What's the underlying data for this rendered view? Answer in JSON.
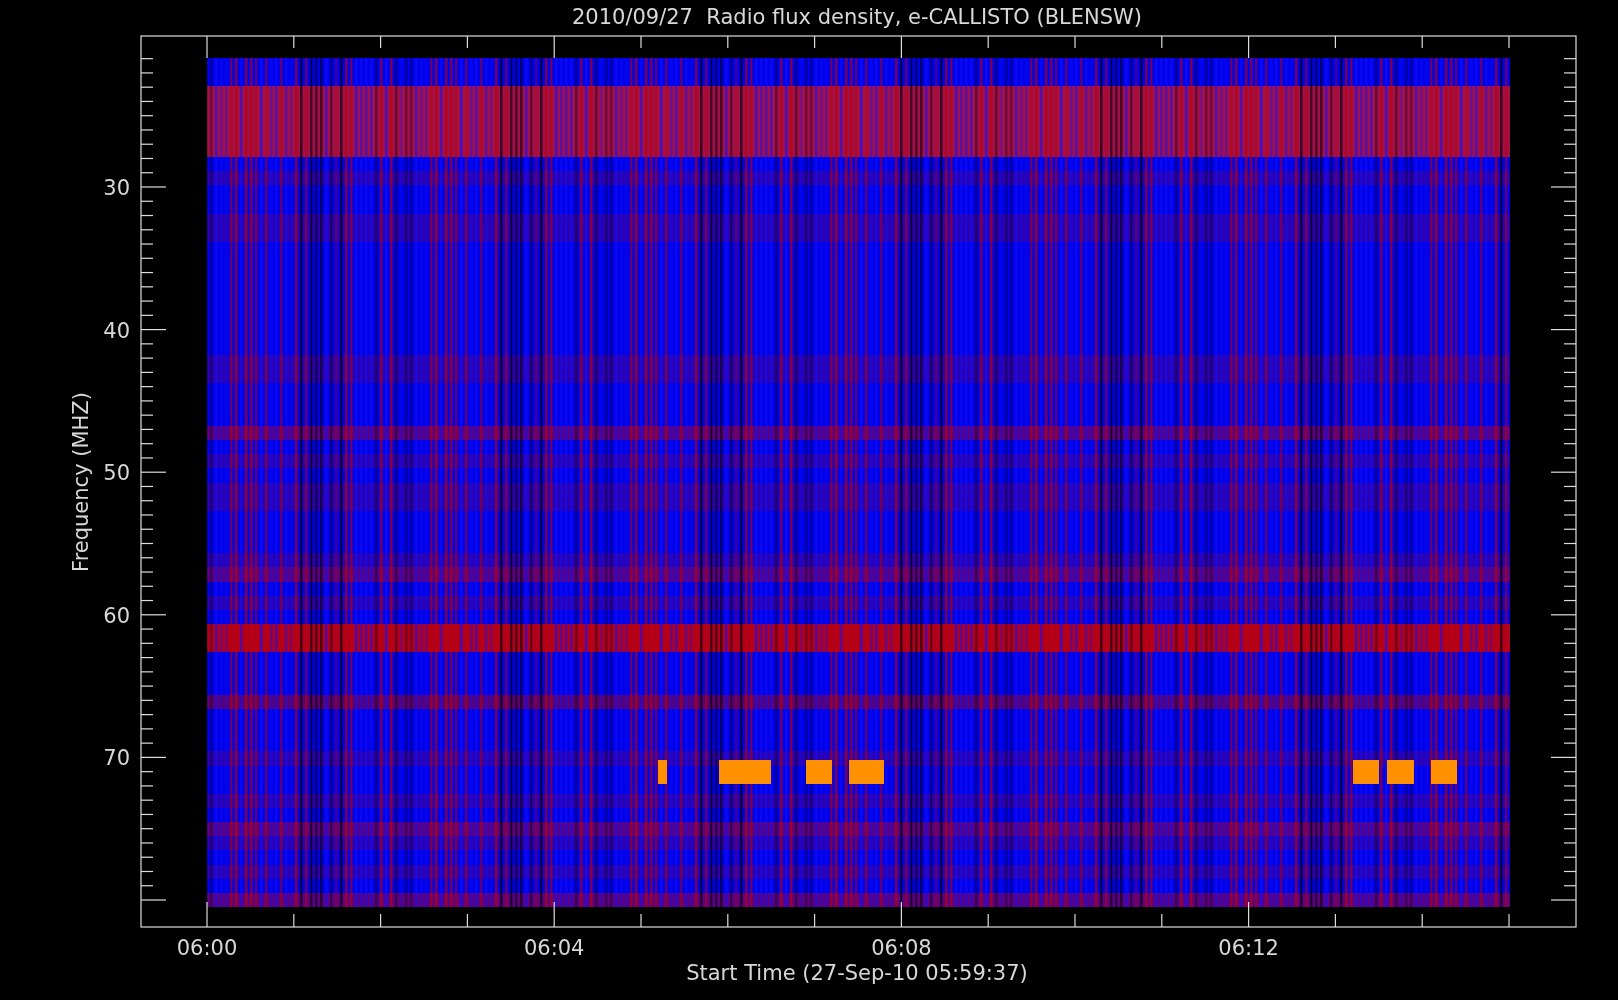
{
  "title": "2010/09/27  Radio flux density, e-CALLISTO (BLENSW)",
  "y_axis": {
    "label": "Frequency (MHZ)",
    "ticks": [
      "30",
      "40",
      "50",
      "60",
      "70"
    ]
  },
  "x_axis": {
    "label": "Start Time (27-Sep-10 05:59:37)",
    "ticks": [
      "06:00",
      "06:04",
      "06:08",
      "06:12"
    ]
  }
}
